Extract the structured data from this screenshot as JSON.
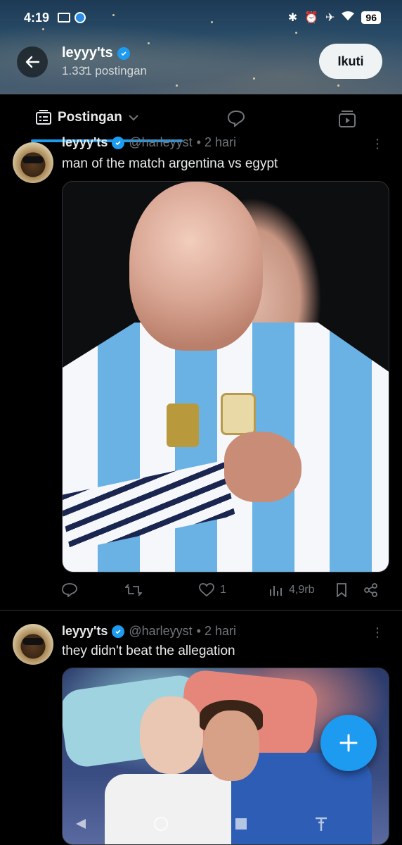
{
  "status_bar": {
    "time": "4:19",
    "battery": "96",
    "icons": [
      "bluetooth-icon",
      "alarm-icon",
      "airplane-icon",
      "wifi-icon"
    ]
  },
  "profile": {
    "name": "leyyy'ts",
    "posts_count": "1.331 postingan",
    "follow_label": "Ikuti"
  },
  "tabs": {
    "posts_label": "Postingan"
  },
  "tweets": [
    {
      "name": "leyyy'ts",
      "handle": "@harleyyst",
      "time": "• 2 hari",
      "text": "man of the match argentina vs egypt",
      "likes": "1",
      "views": "4,9rb"
    },
    {
      "name": "leyyy'ts",
      "handle": "@harleyyst",
      "time": "• 2 hari",
      "text": "they didn't beat the allegation"
    }
  ],
  "colors": {
    "accent": "#1d9bf0",
    "background": "#000000",
    "text": "#e7e9ea",
    "muted": "#71767b"
  }
}
